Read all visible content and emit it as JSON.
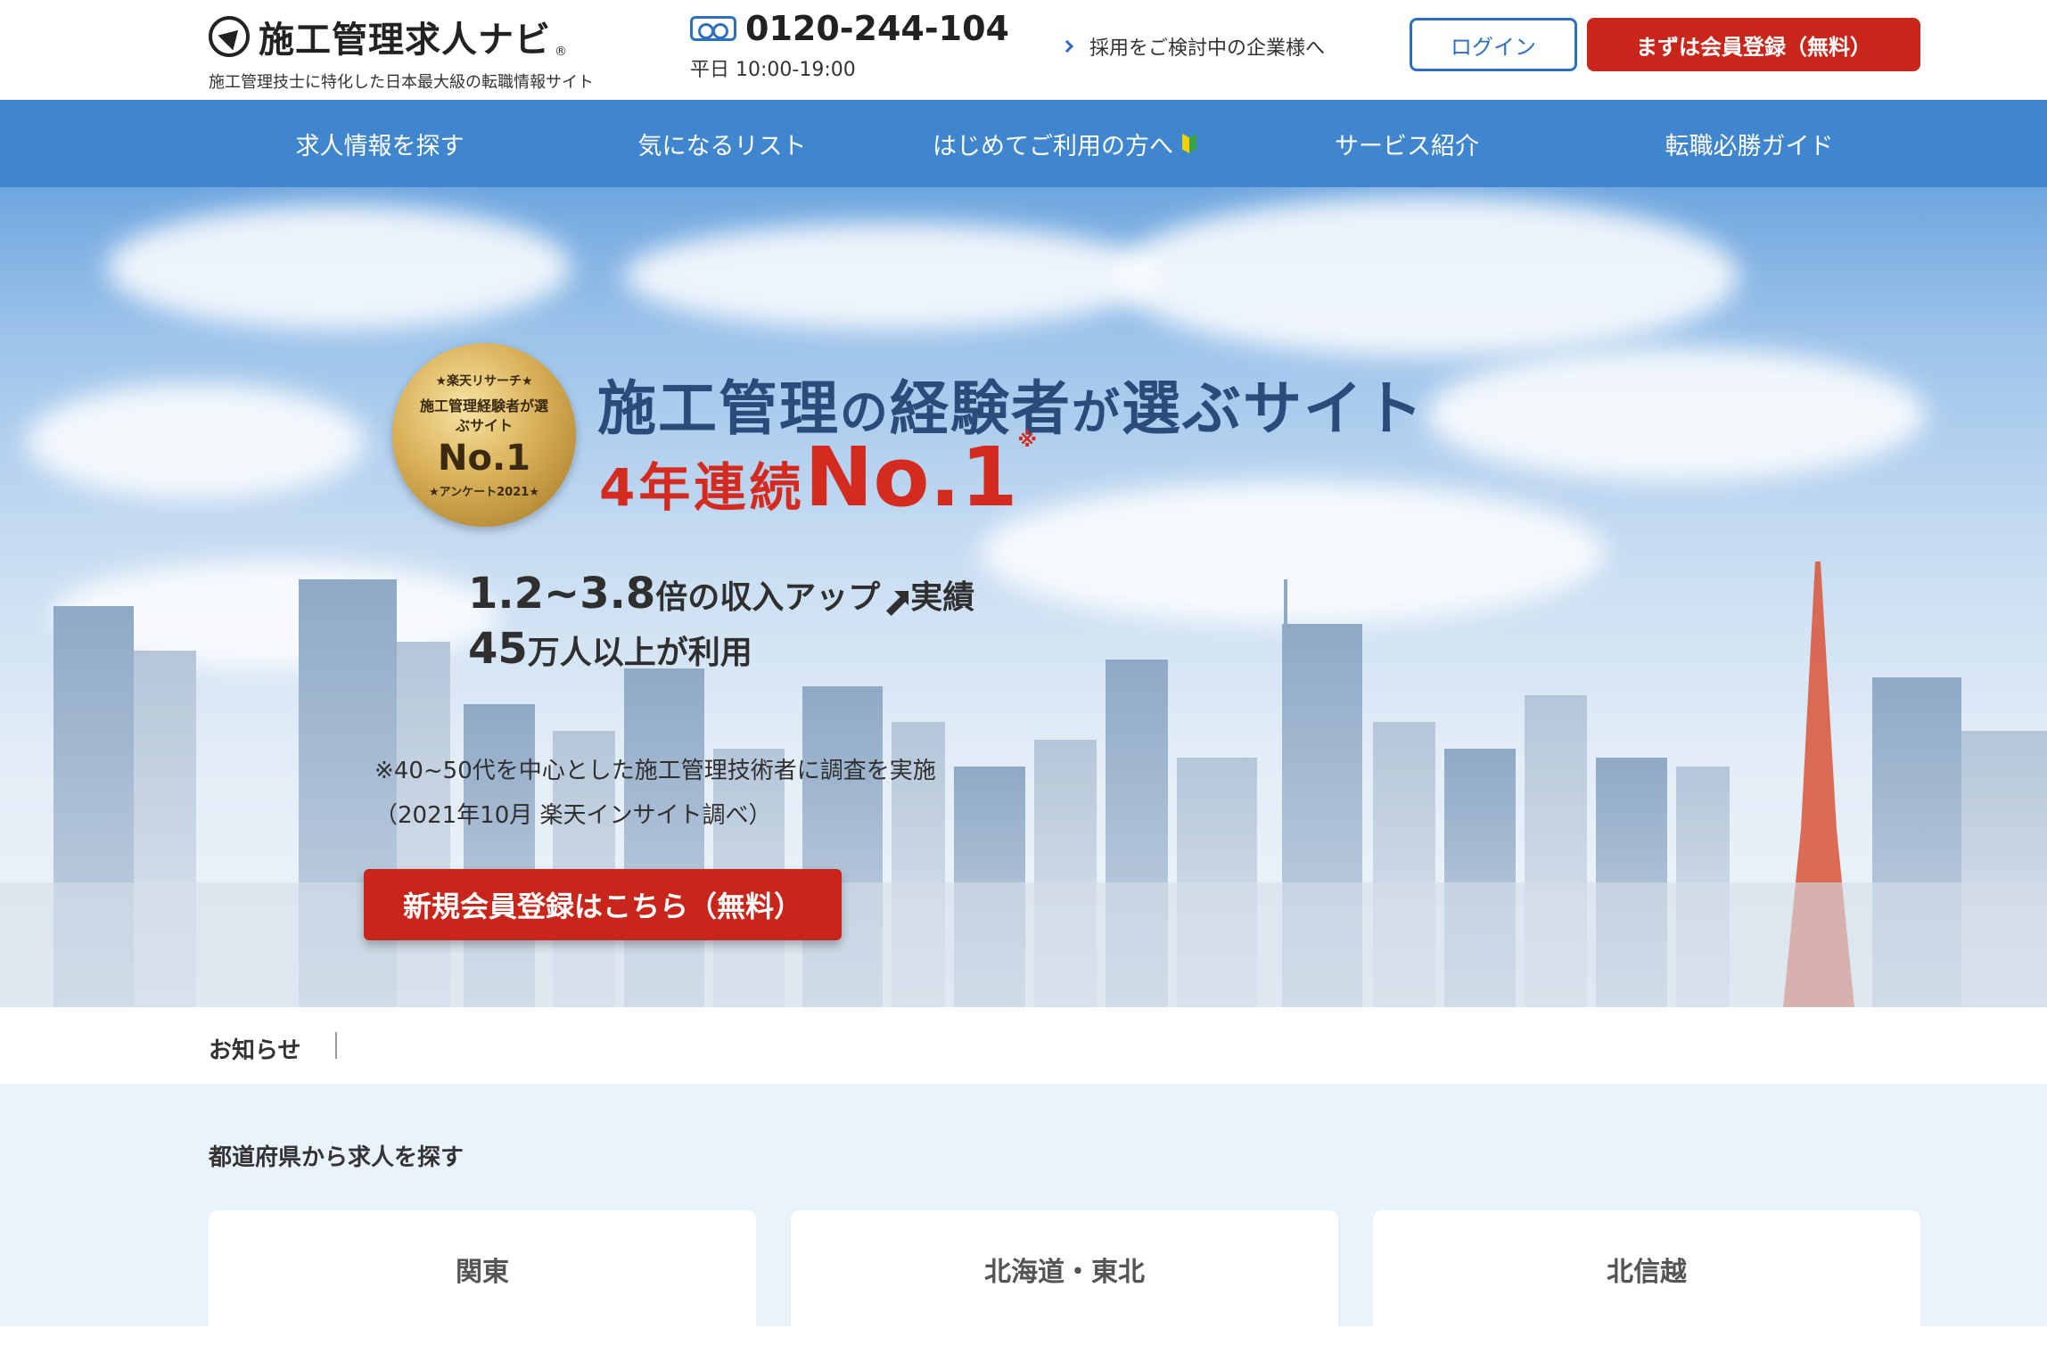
{
  "header": {
    "logo_title": "施工管理求人ナビ",
    "logo_reg": "®",
    "logo_subtitle": "施工管理技士に特化した日本最大級の転職情報サイト",
    "phone_number": "0120-244-104",
    "phone_hours": "平日 10:00-19:00",
    "corp_link": "採用をご検討中の企業様へ",
    "login_label": "ログイン",
    "register_label": "まずは会員登録（無料）"
  },
  "nav": {
    "items": [
      {
        "label": "求人情報を探す"
      },
      {
        "label": "気になるリスト"
      },
      {
        "label": "はじめてご利用の方へ"
      },
      {
        "label": "サービス紹介"
      },
      {
        "label": "転職必勝ガイド"
      }
    ]
  },
  "hero": {
    "badge": {
      "top": "★楽天リサーチ★",
      "middle": "施工管理経験者が選ぶサイト",
      "no1": "No.1",
      "bottom": "★アンケート2021★"
    },
    "headline_part1": "施工管理",
    "headline_part2": "の",
    "headline_part3": "経験者",
    "headline_part4": "が",
    "headline_part5": "選ぶサイト",
    "sub_part1": "4年連続",
    "sub_part2": "No.1",
    "sub_note": "※",
    "stat1_num": "1.2~3.8",
    "stat1_txt1": "倍の収入アップ",
    "stat1_txt2": "実績",
    "stat2_num": "45",
    "stat2_txt": "万人以上が利用",
    "footnote_line1": "※40~50代を中心とした施工管理技術者に調査を実施",
    "footnote_line2": "（2021年10月 楽天インサイト調べ）",
    "cta_label": "新規会員登録はこちら（無料）"
  },
  "news": {
    "label": "お知らせ"
  },
  "prefecture": {
    "title": "都道府県から求人を探す",
    "regions": [
      {
        "label": "関東"
      },
      {
        "label": "北海道・東北"
      },
      {
        "label": "北信越"
      }
    ]
  },
  "colors": {
    "nav_bg": "#3f86cf",
    "accent_red": "#c9261b",
    "accent_blue": "#2e6fc0",
    "section_bg": "#eaf2fb"
  }
}
